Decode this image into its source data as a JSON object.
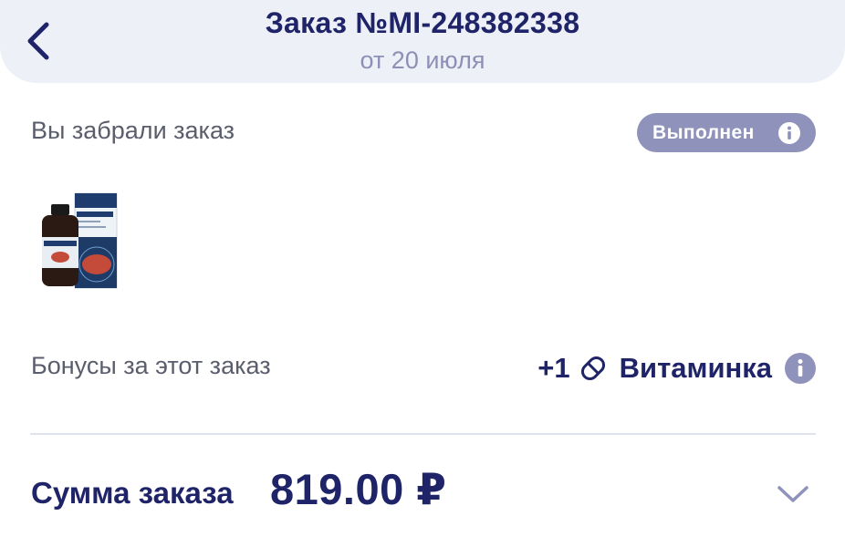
{
  "header": {
    "title": "Заказ №MI-248382338",
    "subtitle": "от 20 июля"
  },
  "status": {
    "text": "Вы забрали заказ",
    "badge": "Выполнен"
  },
  "product": {
    "image_icon": "syrup-bottle-with-box"
  },
  "bonus": {
    "label": "Бонусы за этот заказ",
    "amount": "+1",
    "currency": "Витаминка",
    "icon": "pill-icon"
  },
  "total": {
    "label": "Сумма заказа",
    "amount": "819.00 ₽"
  },
  "colors": {
    "primary": "#1f2468",
    "header_bg": "#eef0f8",
    "badge_bg": "#8f93bb",
    "muted_text": "#5a5d6b",
    "subtitle": "#8d8fb6"
  }
}
